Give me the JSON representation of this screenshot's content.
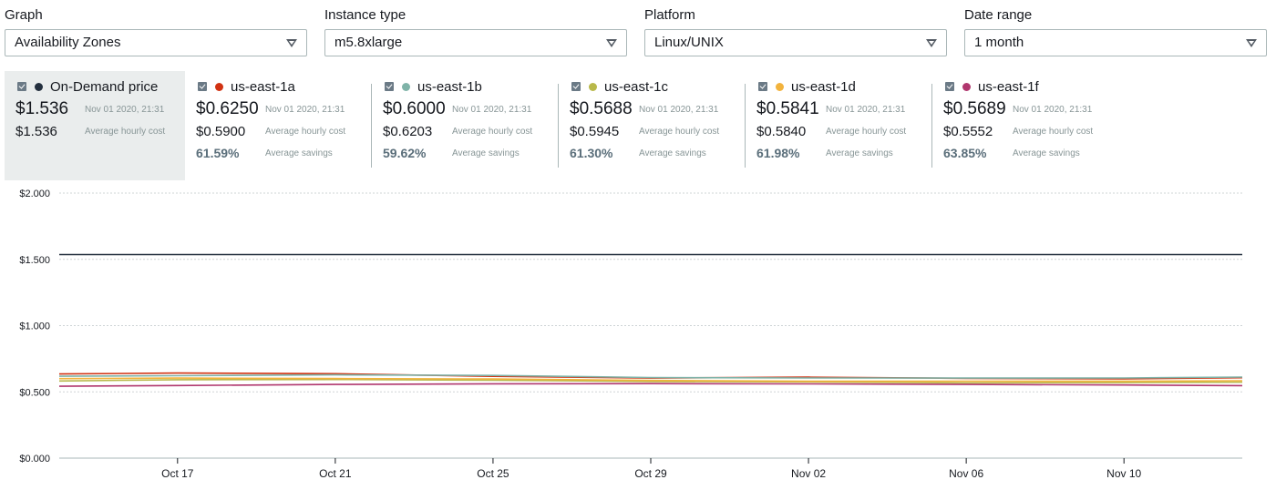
{
  "filters": {
    "graph": {
      "label": "Graph",
      "value": "Availability Zones"
    },
    "instance_type": {
      "label": "Instance type",
      "value": "m5.8xlarge"
    },
    "platform": {
      "label": "Platform",
      "value": "Linux/UNIX"
    },
    "date_range": {
      "label": "Date range",
      "value": "1 month"
    }
  },
  "legend": [
    {
      "name": "On-Demand price",
      "color": "#232f3e",
      "price": "$1.536",
      "timestamp": "Nov 01 2020, 21:31",
      "average": "$1.536",
      "average_label": "Average hourly cost",
      "selected": true
    },
    {
      "name": "us-east-1a",
      "color": "#d13212",
      "price": "$0.6250",
      "timestamp": "Nov 01 2020, 21:31",
      "average": "$0.5900",
      "average_label": "Average hourly cost",
      "savings": "61.59%",
      "savings_label": "Average savings"
    },
    {
      "name": "us-east-1b",
      "color": "#7fb3a8",
      "price": "$0.6000",
      "timestamp": "Nov 01 2020, 21:31",
      "average": "$0.6203",
      "average_label": "Average hourly cost",
      "savings": "59.62%",
      "savings_label": "Average savings"
    },
    {
      "name": "us-east-1c",
      "color": "#b8b84a",
      "price": "$0.5688",
      "timestamp": "Nov 01 2020, 21:31",
      "average": "$0.5945",
      "average_label": "Average hourly cost",
      "savings": "61.30%",
      "savings_label": "Average savings"
    },
    {
      "name": "us-east-1d",
      "color": "#f2b33d",
      "price": "$0.5841",
      "timestamp": "Nov 01 2020, 21:31",
      "average": "$0.5840",
      "average_label": "Average hourly cost",
      "savings": "61.98%",
      "savings_label": "Average savings"
    },
    {
      "name": "us-east-1f",
      "color": "#b0376e",
      "price": "$0.5689",
      "timestamp": "Nov 01 2020, 21:31",
      "average": "$0.5552",
      "average_label": "Average hourly cost",
      "savings": "63.85%",
      "savings_label": "Average savings"
    }
  ],
  "chart_data": {
    "type": "line",
    "y_tick_labels": [
      "$0.000",
      "$0.500",
      "$1.000",
      "$1.500",
      "$2.000"
    ],
    "y_ticks": [
      0,
      0.5,
      1.0,
      1.5,
      2.0
    ],
    "ylim": [
      0,
      2.0
    ],
    "x_tick_labels": [
      "Oct 17",
      "Oct 21",
      "Oct 25",
      "Oct 29",
      "Nov 02",
      "Nov 06",
      "Nov 10"
    ],
    "x": [
      "Oct 14",
      "Oct 17",
      "Oct 21",
      "Oct 25",
      "Oct 29",
      "Nov 02",
      "Nov 06",
      "Nov 10",
      "Nov 13"
    ],
    "xlim": [
      "Oct 14",
      "Nov 13"
    ],
    "grid": true,
    "series": [
      {
        "name": "On-Demand price",
        "color": "#232f3e",
        "values": [
          1.536,
          1.536,
          1.536,
          1.536,
          1.536,
          1.536,
          1.536,
          1.536,
          1.536
        ]
      },
      {
        "name": "us-east-1a",
        "color": "#d13212",
        "values": [
          0.635,
          0.642,
          0.637,
          0.617,
          0.604,
          0.611,
          0.602,
          0.598,
          0.607
        ]
      },
      {
        "name": "us-east-1b",
        "color": "#7fb3a8",
        "values": [
          0.618,
          0.622,
          0.628,
          0.624,
          0.608,
          0.605,
          0.604,
          0.605,
          0.612
        ]
      },
      {
        "name": "us-east-1c",
        "color": "#b8b84a",
        "values": [
          0.582,
          0.592,
          0.593,
          0.588,
          0.578,
          0.575,
          0.568,
          0.57,
          0.573
        ]
      },
      {
        "name": "us-east-1d",
        "color": "#f2b33d",
        "values": [
          0.6,
          0.604,
          0.601,
          0.597,
          0.586,
          0.58,
          0.581,
          0.58,
          0.584
        ]
      },
      {
        "name": "us-east-1f",
        "color": "#b0376e",
        "values": [
          0.542,
          0.548,
          0.556,
          0.561,
          0.562,
          0.56,
          0.556,
          0.552,
          0.547
        ]
      }
    ]
  }
}
